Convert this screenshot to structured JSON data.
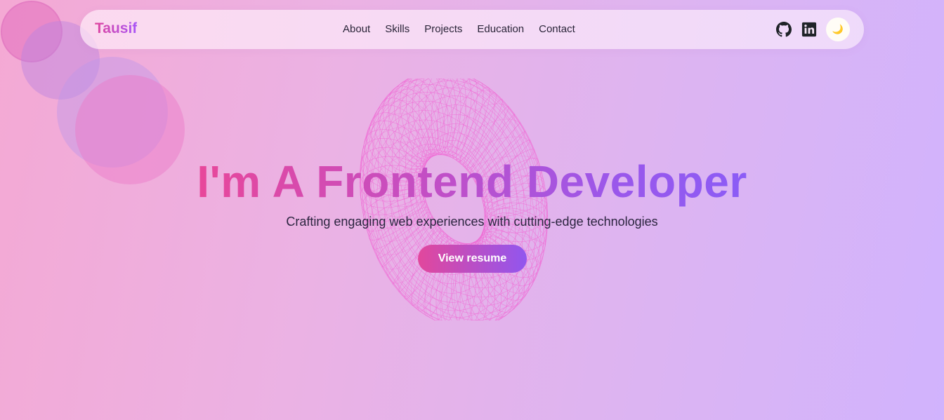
{
  "nav": {
    "brand": "Tausif",
    "links": [
      "About",
      "Skills",
      "Projects",
      "Education",
      "Contact"
    ],
    "icons": [
      "github-icon",
      "linkedin-icon"
    ],
    "theme_toggle_icon": "moon-icon"
  },
  "hero": {
    "headline": "I'm A Frontend Developer",
    "subtitle": "Crafting engaging web experiences with cutting-edge technologies",
    "cta_label": "View resume"
  },
  "colors": {
    "accent_pink": "#e2479c",
    "accent_purple": "#9156ef",
    "torus": "#f06bd6"
  }
}
